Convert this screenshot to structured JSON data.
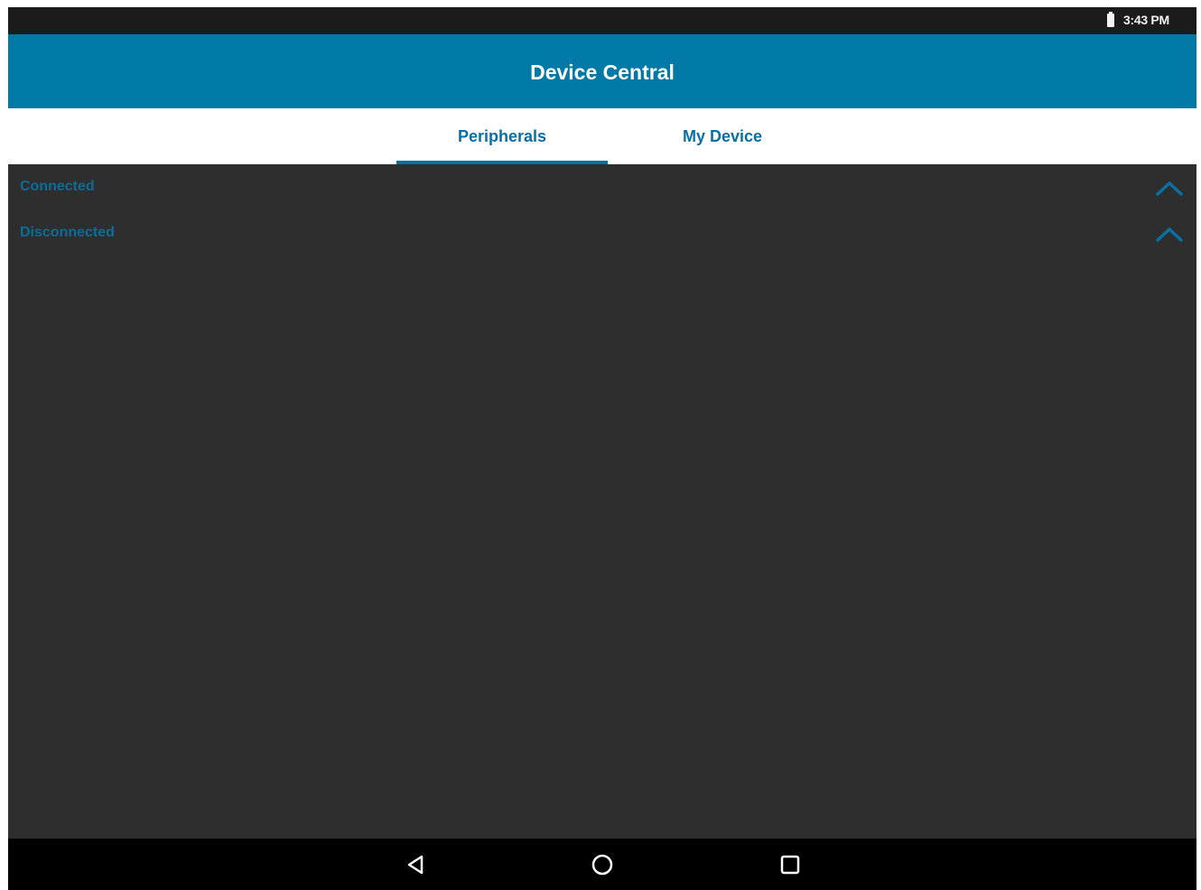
{
  "status_bar": {
    "time": "3:43 PM",
    "battery_icon": "battery-icon"
  },
  "app_bar": {
    "title": "Device Central"
  },
  "tabs": [
    {
      "label": "Peripherals",
      "selected": true
    },
    {
      "label": "My Device",
      "selected": false
    }
  ],
  "sections": [
    {
      "label": "Connected",
      "icon": "chevron-up-icon",
      "expanded": true
    },
    {
      "label": "Disconnected",
      "icon": "chevron-up-icon",
      "expanded": true
    }
  ],
  "nav_bar": {
    "back_icon": "back-triangle-icon",
    "home_icon": "home-circle-icon",
    "recents_icon": "recents-square-icon"
  },
  "colors": {
    "app_bar": "#0079a7",
    "accent": "#0a6fa3",
    "section_text": "#0b6d97",
    "content_background": "#2e2e2e",
    "status_bar": "#1b1b1b",
    "nav_bar": "#000000"
  }
}
